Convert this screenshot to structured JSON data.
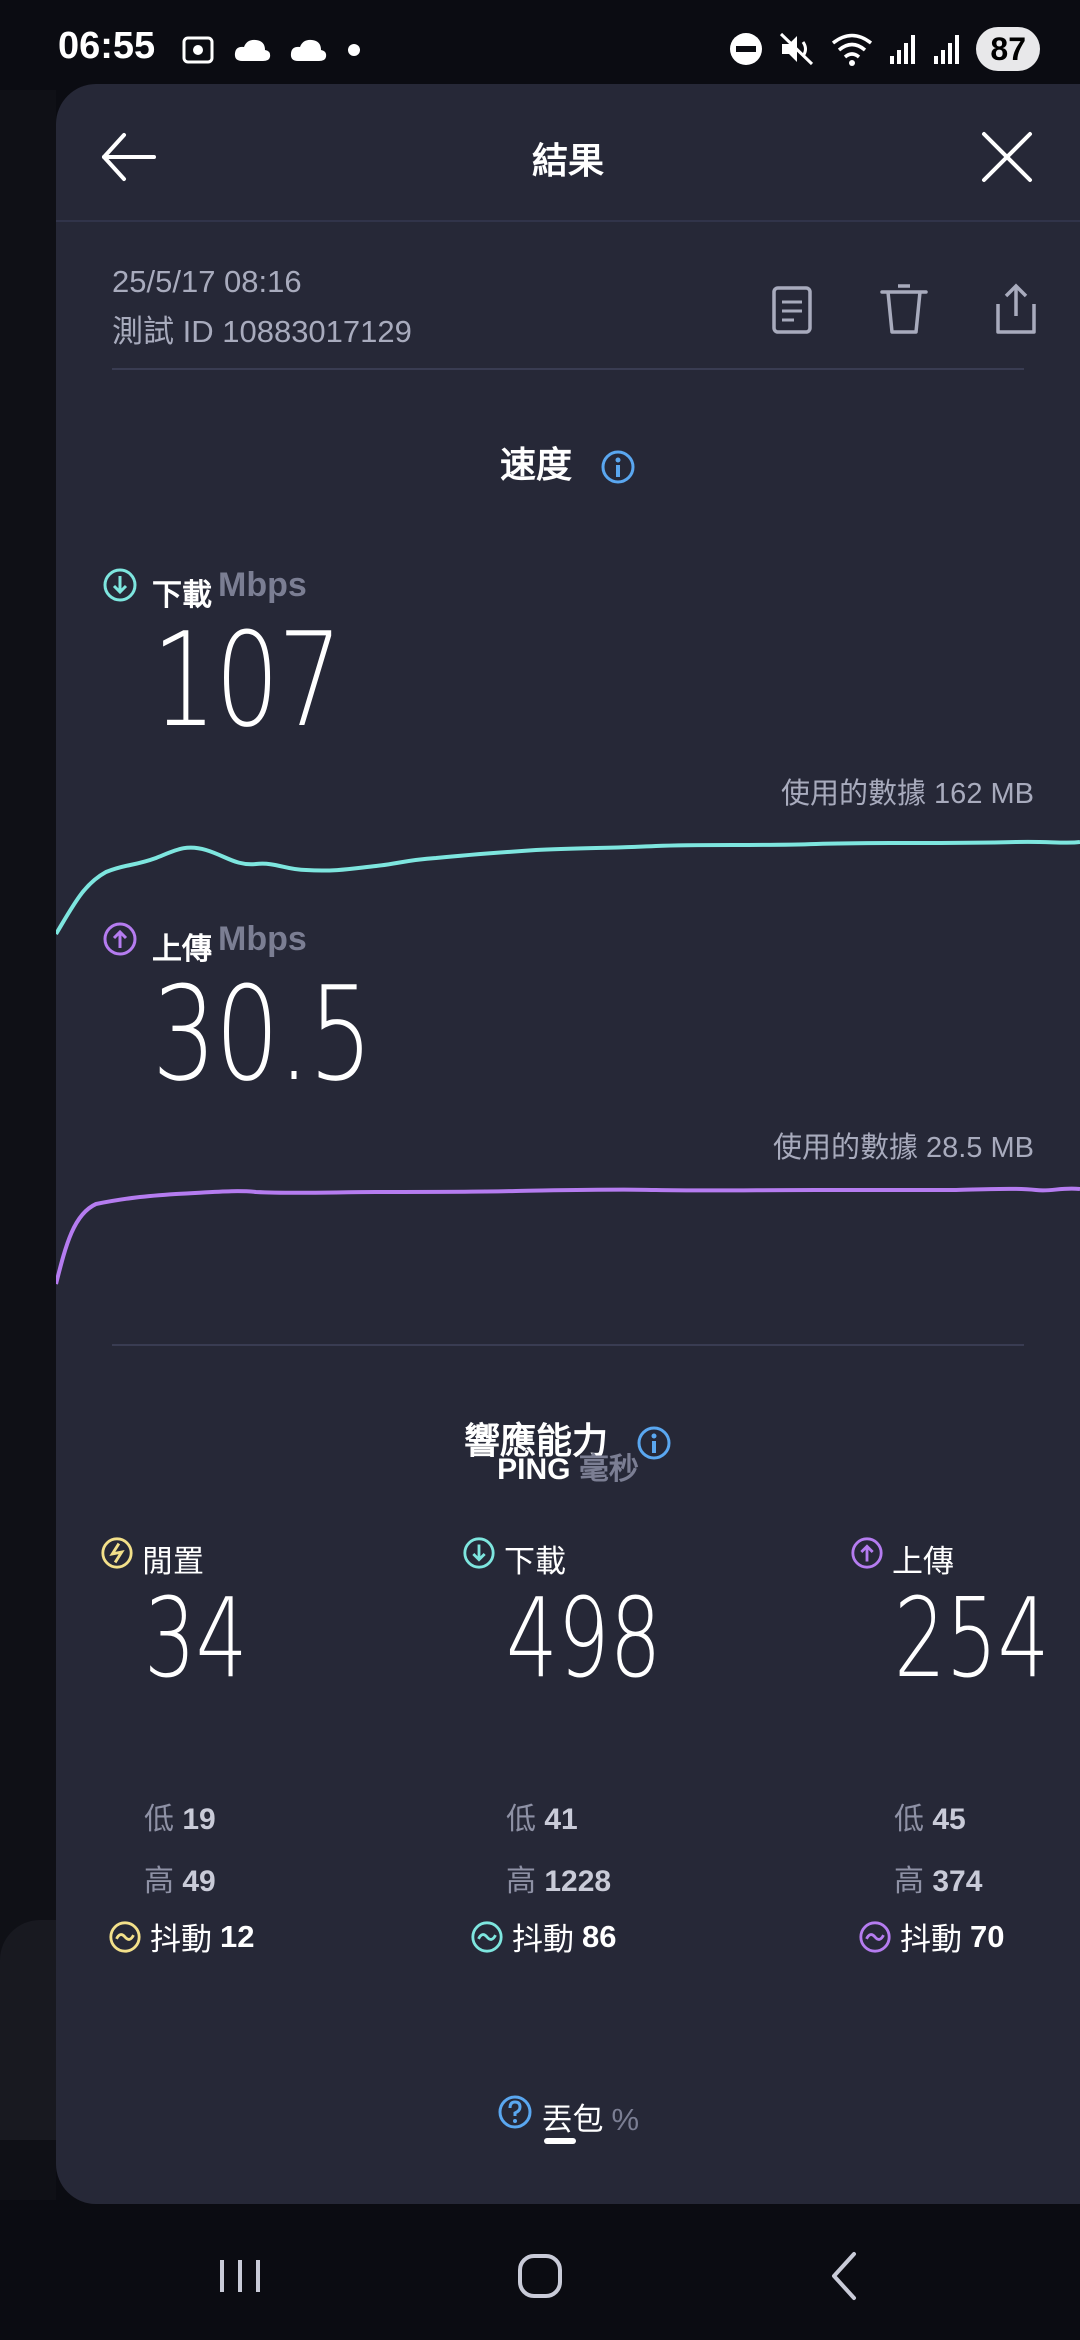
{
  "status_bar": {
    "time": "06:55",
    "battery": "87",
    "left_icons": [
      "screenshot-icon",
      "cloud-icon",
      "cloud-icon",
      "dot-icon"
    ],
    "right_icons": [
      "do-not-disturb-icon",
      "mute-icon",
      "wifi-icon",
      "signal-icon",
      "signal-icon"
    ]
  },
  "header": {
    "title": "結果"
  },
  "meta": {
    "date": "25/5/17 08:16",
    "test_id": "測試 ID 10883017129"
  },
  "speed": {
    "title": "速度",
    "download": {
      "label": "下載",
      "unit": "Mbps",
      "value": "107",
      "data_used": "使用的數據 162 MB",
      "color": "#7ee6df"
    },
    "upload": {
      "label": "上傳",
      "unit": "Mbps",
      "value": "30.5",
      "data_used": "使用的數據 28.5 MB",
      "color": "#b57cf0"
    }
  },
  "responsiveness": {
    "title": "響應能力",
    "ping_label": "PING",
    "ping_unit": "毫秒",
    "columns": [
      {
        "label": "閒置",
        "value": "34",
        "low_label": "低",
        "low": "19",
        "high_label": "高",
        "high": "49",
        "jitter_label": "抖動",
        "jitter": "12",
        "color": "#f3e08a"
      },
      {
        "label": "下載",
        "value": "498",
        "low_label": "低",
        "low": "41",
        "high_label": "高",
        "high": "1228",
        "jitter_label": "抖動",
        "jitter": "86",
        "color": "#7ee6df"
      },
      {
        "label": "上傳",
        "value": "254",
        "low_label": "低",
        "low": "45",
        "high_label": "高",
        "high": "374",
        "jitter_label": "抖動",
        "jitter": "70",
        "color": "#b57cf0"
      }
    ]
  },
  "packet_loss": {
    "label": "丟包",
    "unit": "%"
  },
  "colors": {
    "sheet_bg": "#262837",
    "info_blue": "#5aa7f0",
    "background": "#0b0c12"
  }
}
